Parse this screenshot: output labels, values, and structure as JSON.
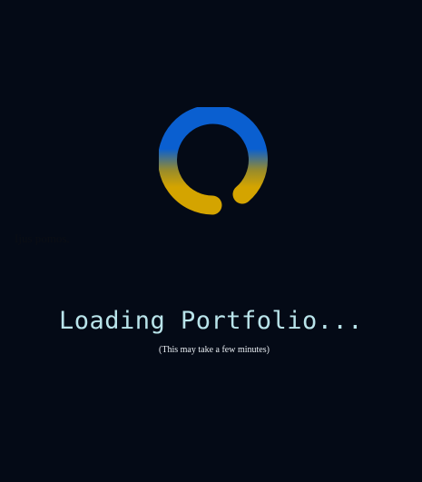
{
  "loader": {
    "icon": "spinner-icon",
    "colors": {
      "top": "#0a5fd0",
      "bottom": "#d4a400"
    }
  },
  "hidden_text": "Ijus pomos.",
  "title": "Loading Portfolio...",
  "subtitle": "(This may take a few minutes)",
  "colors": {
    "background": "#040a16",
    "title": "#b9e4ea",
    "subtitle": "#e8edf2"
  }
}
